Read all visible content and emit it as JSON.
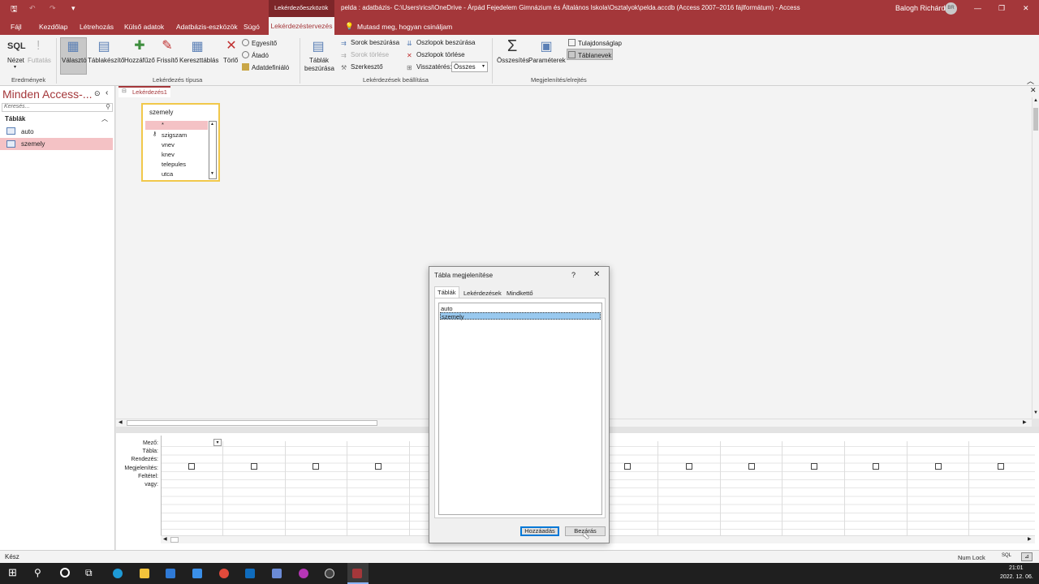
{
  "titlebar": {
    "context_tab": "Lekérdezőeszközök",
    "title": "pelda : adatbázis- C:\\Users\\ricsi\\OneDrive - Árpád Fejedelem Gimnázium és Általános Iskola\\Osztalyok\\pelda.accdb (Access 2007–2016 fájlformátum)  -  Access",
    "user": "Balogh Richárd",
    "user_initials": "BR"
  },
  "tabs": [
    "Fájl",
    "Kezdőlap",
    "Létrehozás",
    "Külső adatok",
    "Adatbázis-eszközök",
    "Súgó"
  ],
  "active_tab": "Lekérdezéstervezés",
  "tell_me": "Mutasd meg, hogyan csináljam",
  "ribbon": {
    "sql": "SQL",
    "nezet": "Nézet",
    "futtatas": "Futtatás",
    "valaszto": "Választó",
    "tablakeszito": "Táblakészítő",
    "hozzafuzo": "Hozzáfűző",
    "frissito": "Frissítő",
    "kereszttablas": "Kereszttáblás",
    "torlo": "Törlő",
    "egyesito": "Egyesítő",
    "atado": "Átadó",
    "adatdefinialo": "Adatdefiniáló",
    "tablak_beszurasa_1": "Táblák",
    "tablak_beszurasa_2": "beszúrása",
    "sorok_beszurasa": "Sorok beszúrása",
    "sorok_torlese": "Sorok törlése",
    "szerkeszto": "Szerkesztő",
    "oszlopok_beszurasa": "Oszlopok beszúrása",
    "oszlopok_torlese": "Oszlopok törlése",
    "visszateres": "Visszatérés:",
    "visszateres_value": "Összes",
    "osszesites": "Összesítés",
    "parameterek": "Paraméterek",
    "tulajdonsaglap": "Tulajdonságlap",
    "tablanevek": "Táblanevek",
    "group_eredmenyek": "Eredmények",
    "group_lekerdezes_tipusa": "Lekérdezés típusa",
    "group_beallitasa": "Lekérdezések beállítása",
    "group_megjelenites": "Megjelenítés/elrejtés"
  },
  "nav": {
    "title": "Minden Access-...",
    "search_placeholder": "Keresés...",
    "section": "Táblák",
    "items": [
      "auto",
      "szemely"
    ]
  },
  "doc_tab": "Lekérdezés1",
  "table_box": {
    "name": "szemely",
    "fields": [
      "*",
      "szigszam",
      "vnev",
      "knev",
      "telepules",
      "utca"
    ]
  },
  "grid_labels": [
    "Mező:",
    "Tábla:",
    "Rendezés:",
    "Megjelenítés:",
    "Feltétel:",
    "vagy:"
  ],
  "dialog": {
    "title": "Tábla megjelenítése",
    "help": "?",
    "close": "✕",
    "tabs": [
      "Táblák",
      "Lekérdezések",
      "Mindkettő"
    ],
    "list": [
      "auto",
      "szemely"
    ],
    "add": "Hozzáadás",
    "close_btn": "Bezárás"
  },
  "status": {
    "left": "Kész",
    "numlock": "Num Lock",
    "sql": "SQL"
  },
  "clock": {
    "time": "21:01",
    "date": "2022. 12. 06."
  },
  "colors": {
    "access_red": "#a4373a",
    "selection_blue": "#99c9ef",
    "nav_selected": "#f4c2c5"
  }
}
